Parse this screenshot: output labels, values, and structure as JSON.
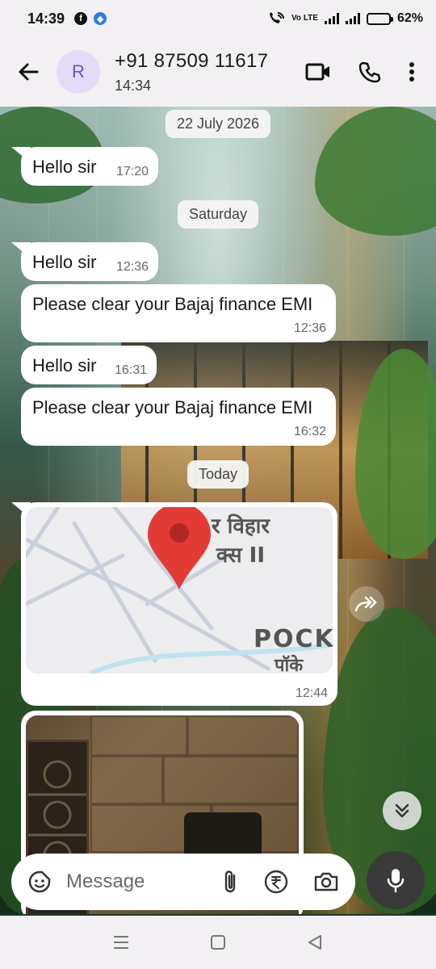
{
  "status_bar": {
    "time": "14:39",
    "battery_text": "62%",
    "battery_level": 0.62,
    "network_label": "Vo LTE",
    "icons": [
      "facebook-icon",
      "app-icon",
      "wifi-call-icon",
      "signal-icon",
      "signal-icon",
      "battery-icon"
    ]
  },
  "header": {
    "avatar_letter": "R",
    "contact_name": "+91 87509 11617",
    "subtitle": "14:34",
    "actions": [
      "back-arrow-icon",
      "video-call-icon",
      "phone-icon",
      "more-vert-icon"
    ]
  },
  "chat": {
    "date_chips": [
      "22 July 2026",
      "Saturday",
      "Today"
    ],
    "messages": [
      {
        "text": "Hello sir",
        "time": "17:20"
      },
      {
        "text": "Hello sir",
        "time": "12:36"
      },
      {
        "text": "Please clear your Bajaj finance EMI",
        "time": "12:36"
      },
      {
        "text": "Hello sir",
        "time": "16:31"
      },
      {
        "text": "Please clear your Bajaj finance EMI",
        "time": "16:32"
      }
    ],
    "location_message": {
      "time": "12:44",
      "map_text": [
        "र विहार",
        "क्स II",
        "POCK",
        "पॉके"
      ]
    }
  },
  "composer": {
    "placeholder": "Message",
    "tools": [
      "sticker-icon",
      "attach-icon",
      "rupee-icon",
      "camera-icon",
      "mic-icon"
    ]
  },
  "colors": {
    "header_bg": "#f3f0f4",
    "avatar_bg": "#e4dcf6",
    "avatar_fg": "#6d52b8",
    "bubble_bg": "#ffffff",
    "map_pin": "#e23b36",
    "battery_fill": "#f2b80f",
    "mic_bg": "#3a3a3a"
  }
}
